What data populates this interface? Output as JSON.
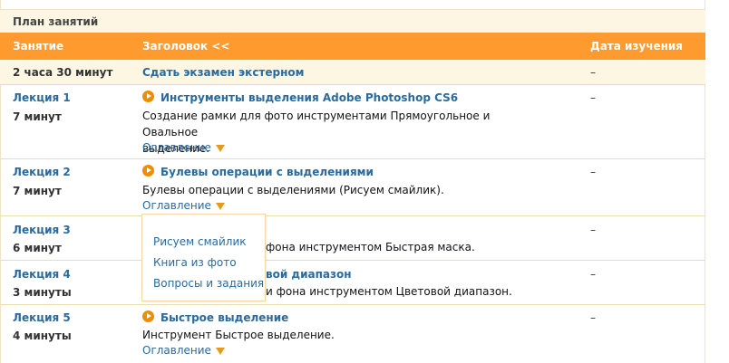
{
  "plan_title": "План занятий",
  "header": {
    "col_lesson": "Занятие",
    "col_title": "Заголовок <<",
    "col_date": "Дата изучения"
  },
  "exam_row": {
    "duration": "2 часа 30 минут",
    "title": "Сдать экзамен экстерном",
    "date": "–"
  },
  "lectures": [
    {
      "name": "Лекция 1",
      "duration": "7 минут",
      "title": "Инструменты выделения Adobe Photoshop CS6",
      "desc_line1": "Создание рамки для фото инструментами Прямоугольное и Овальное",
      "desc_line2": "выделение.",
      "toc": "Оглавление",
      "date": "–"
    },
    {
      "name": "Лекция 2",
      "duration": "7 минут",
      "title": "Булевы операции с выделениями",
      "desc_line1": "Булевы операции с выделениями (Рисуем смайлик).",
      "toc": "Оглавление",
      "date": "–"
    },
    {
      "name": "Лекция 3",
      "duration": "6 минут",
      "desc_line1": "фона инструментом Быстрая маска.",
      "date": "–"
    },
    {
      "name": "Лекция 4",
      "duration": "3 минуты",
      "title": "вой диапазон",
      "desc_line1": "и фона инструментом Цветовой диапазон.",
      "date": "–"
    },
    {
      "name": "Лекция 5",
      "duration": "4 минуты",
      "title": "Быстрое выделение",
      "desc_line1": "Инструмент Быстрое выделение.",
      "toc": "Оглавление",
      "date": "–"
    }
  ],
  "toc_popup": {
    "items": [
      "Рисуем смайлик",
      "Книга из фото",
      "Вопросы и задания"
    ]
  },
  "colors": {
    "header_bg": "#ff9a2e",
    "link": "#2a6a9c",
    "panel_bg": "#fdf6e3",
    "play_icon": "#f08c00",
    "toc_arrow": "#e59a1a"
  }
}
